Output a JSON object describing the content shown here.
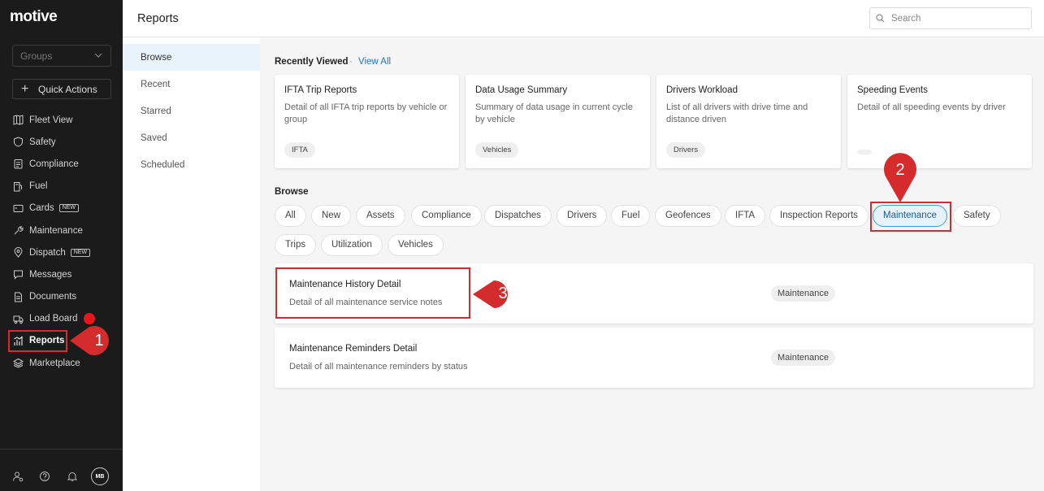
{
  "brand": {
    "logo_text": "motive"
  },
  "sidebar": {
    "groups_placeholder": "Groups",
    "quick_actions": "Quick Actions",
    "items": [
      {
        "label": "Fleet View",
        "icon": "map-icon"
      },
      {
        "label": "Safety",
        "icon": "shield-icon"
      },
      {
        "label": "Compliance",
        "icon": "clipboard-icon"
      },
      {
        "label": "Fuel",
        "icon": "fuel-pump-icon"
      },
      {
        "label": "Cards",
        "icon": "card-icon",
        "badge": "NEW"
      },
      {
        "label": "Maintenance",
        "icon": "wrench-icon"
      },
      {
        "label": "Dispatch",
        "icon": "route-pin-icon",
        "badge": "NEW"
      },
      {
        "label": "Messages",
        "icon": "chat-icon"
      },
      {
        "label": "Documents",
        "icon": "document-icon"
      },
      {
        "label": "Load Board",
        "icon": "truck-icon",
        "notification_dot": true
      },
      {
        "label": "Reports",
        "icon": "bar-chart-icon",
        "active": true
      },
      {
        "label": "Marketplace",
        "icon": "layers-icon"
      }
    ],
    "footer": {
      "avatar_initials": "MB"
    }
  },
  "header": {
    "title": "Reports",
    "search_placeholder": "Search"
  },
  "subnav": {
    "items": [
      "Browse",
      "Recent",
      "Starred",
      "Saved",
      "Scheduled"
    ],
    "active": "Browse"
  },
  "recently_viewed": {
    "title": "Recently Viewed",
    "separator": "·",
    "view_all": "View All",
    "cards": [
      {
        "title": "IFTA Trip Reports",
        "desc": "Detail of all IFTA trip reports by vehicle or group",
        "tag": "IFTA"
      },
      {
        "title": "Data Usage Summary",
        "desc": "Summary of data usage in current cycle by vehicle",
        "tag": "Vehicles"
      },
      {
        "title": "Drivers Workload",
        "desc": "List of all drivers with drive time and distance driven",
        "tag": "Drivers"
      },
      {
        "title": "Speeding Events",
        "desc": "Detail of all speeding events by driver",
        "tag": ""
      }
    ]
  },
  "browse": {
    "title": "Browse",
    "chips": [
      "All",
      "New",
      "Assets",
      "Compliance",
      "Dispatches",
      "Drivers",
      "Fuel",
      "Geofences",
      "IFTA",
      "Inspection Reports",
      "Maintenance",
      "Safety",
      "Trips",
      "Utilization",
      "Vehicles"
    ],
    "active_chip": "Maintenance"
  },
  "results": [
    {
      "title": "Maintenance History Detail",
      "desc": "Detail of all maintenance service notes",
      "tag": "Maintenance"
    },
    {
      "title": "Maintenance Reminders Detail",
      "desc": "Detail of all maintenance reminders by status",
      "tag": "Maintenance"
    }
  ],
  "callouts": [
    "1",
    "2",
    "3"
  ],
  "colors": {
    "sidebar_bg": "#1b1b1b",
    "accent_blue": "#1a73c8",
    "callout_red": "#d42c2c",
    "highlight_red": "#d42c2c",
    "active_chip_bg": "#e6f2fc",
    "notification_red": "#e8161a"
  }
}
